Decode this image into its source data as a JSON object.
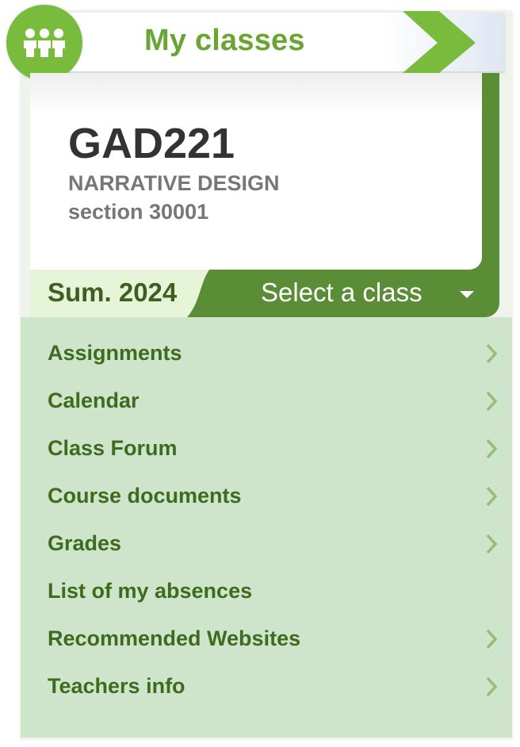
{
  "header": {
    "title": "My classes",
    "icon": "people-icon",
    "arrow_icon": "chevron-right-icon"
  },
  "course": {
    "code": "GAD221",
    "name": "NARRATIVE DESIGN",
    "section": "section 30001",
    "term": "Sum. 2024"
  },
  "selector": {
    "label": "Select a class",
    "icon": "caret-down-icon"
  },
  "menu": {
    "items": [
      {
        "label": "Assignments",
        "has_arrow": true
      },
      {
        "label": "Calendar",
        "has_arrow": true
      },
      {
        "label": "Class Forum",
        "has_arrow": true
      },
      {
        "label": "Course documents",
        "has_arrow": true
      },
      {
        "label": "Grades",
        "has_arrow": true
      },
      {
        "label": "List of my absences",
        "has_arrow": false
      },
      {
        "label": "Recommended Websites",
        "has_arrow": true
      },
      {
        "label": "Teachers info",
        "has_arrow": true
      }
    ]
  },
  "colors": {
    "brand_green": "#79bb3d",
    "title_green": "#6aa534",
    "dark_green": "#5b8c36",
    "menu_bg": "#cfe5cb",
    "menu_text": "#3f6b1f",
    "term_bg": "#e6f4d8"
  }
}
